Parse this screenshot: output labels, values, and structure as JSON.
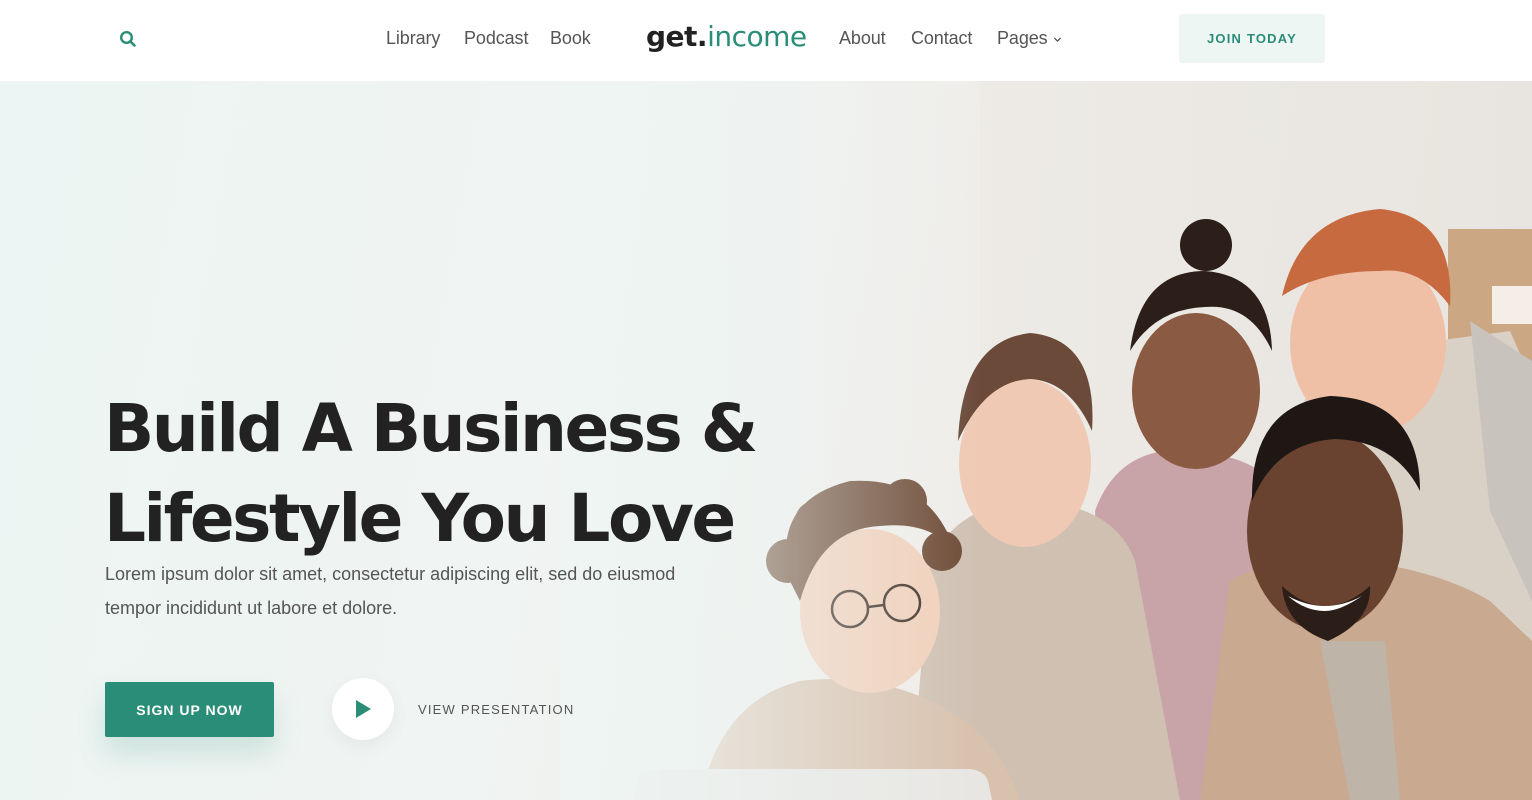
{
  "nav": {
    "logo": {
      "dark": "get",
      "dot": ".",
      "accent": "income"
    },
    "left_links": [
      "Library",
      "Podcast",
      "Book"
    ],
    "right_links": [
      "About",
      "Contact",
      "Pages"
    ],
    "join_label": "JOIN TODAY"
  },
  "hero": {
    "title_line1": "Build A Business &",
    "title_line2": "Lifestyle You Love",
    "subtitle_line1": "Lorem ipsum dolor sit amet, consectetur adipiscing elit, sed do eiusmod",
    "subtitle_line2": "tempor incididunt ut labore et dolore.",
    "signup_label": "SIGN UP NOW",
    "presentation_label": "VIEW PRESENTATION",
    "photo": "team-of-five-people-smiling-at-laptop"
  },
  "colors": {
    "accent": "#2a8d77",
    "accent_light": "#eef6f4",
    "text_dark": "#222222",
    "text_muted": "#555555"
  },
  "icons": {
    "search": "search-icon",
    "pages_dropdown": "chevron-down-icon",
    "play": "play-icon"
  }
}
